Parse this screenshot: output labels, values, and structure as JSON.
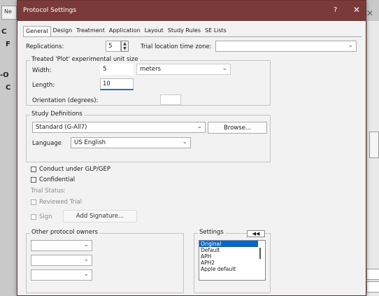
{
  "background": {
    "tab_fragment": "Ne",
    "labels": [
      "C",
      "F",
      "-O",
      "C"
    ]
  },
  "dialog": {
    "title": "Protocol Settings",
    "help": "?",
    "close": "✕"
  },
  "tabs": [
    "General",
    "Design",
    "Treatment",
    "Application",
    "Layout",
    "Study Rules",
    "SE Lists"
  ],
  "general": {
    "replications_label": "Replications:",
    "replications_value": "5",
    "trial_tz_label": "Trial location time zone:",
    "trial_tz_value": "",
    "unit_size_group": "Treated 'Plot' experimental unit size",
    "width_label": "Width:",
    "width_value": "5",
    "units_value": "meters",
    "length_label": "Length:",
    "length_value": "10",
    "orientation_label": "Orientation (degrees):",
    "orientation_value": "",
    "study_definitions_group": "Study Definitions",
    "study_definition_value": "Standard (G-All7)",
    "browse_label": "Browse...",
    "language_label": "Language",
    "language_value": "US English",
    "glp_label": "Conduct under GLP/GEP",
    "confidential_label": "Confidential",
    "trial_status_label": "Trial Status:",
    "reviewed_label": "Reviewed Trial",
    "sign_label": "Sign",
    "add_signature_label": "Add Signature...",
    "owners_group": "Other protocol owners",
    "settings_label": "Settings",
    "settings_btn": "◀◀",
    "settings_items": [
      "Original",
      "Default",
      "APH",
      "APH2",
      "Apple default"
    ]
  }
}
